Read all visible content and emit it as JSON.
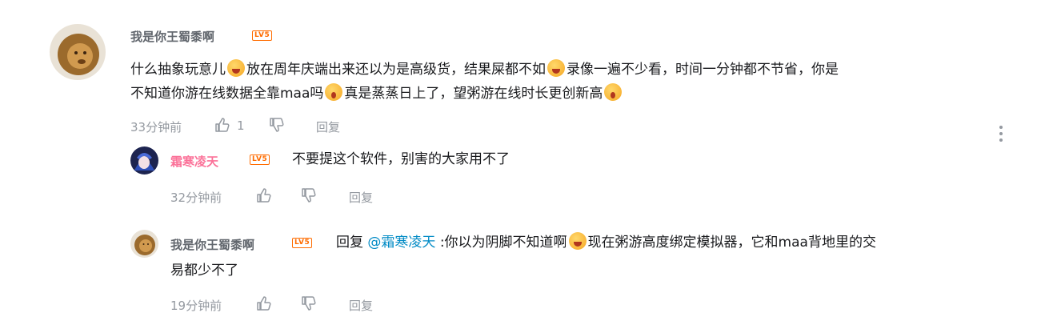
{
  "comment": {
    "username": "我是你王蜀黍啊",
    "level": "LV5",
    "text_line1": "什么抽象玩意儿",
    "text_seg2": "放在周年庆端出来还以为是高级货，结果屎都不如",
    "text_seg3": "录像一遍不少看，时间一分钟都不节省，你是",
    "text_line2a": "不知道你游在线数据全靠maa吗",
    "text_line2b": "真是蒸蒸日上了，望粥游在线时长更创新高",
    "time": "33分钟前",
    "likes": "1",
    "reply_label": "回复"
  },
  "replies": [
    {
      "username": "霜寒凌天",
      "level": "LV5",
      "text": "不要提这个软件，别害的大家用不了",
      "time": "32分钟前",
      "reply_label": "回复"
    },
    {
      "username": "我是你王蜀黍啊",
      "level": "LV5",
      "reply_prefix": "回复",
      "mention": "@霜寒凌天",
      "text_a": ":你以为阴脚不知道啊",
      "text_b": "现在粥游高度绑定模拟器，它和maa背地里的交",
      "text_line2": "易都少不了",
      "time": "19分钟前",
      "reply_label": "回复"
    }
  ],
  "icons": {
    "like": "thumbs-up-icon",
    "dislike": "thumbs-down-icon",
    "more": "more-vertical-icon",
    "emoji": "emoji-icon"
  }
}
